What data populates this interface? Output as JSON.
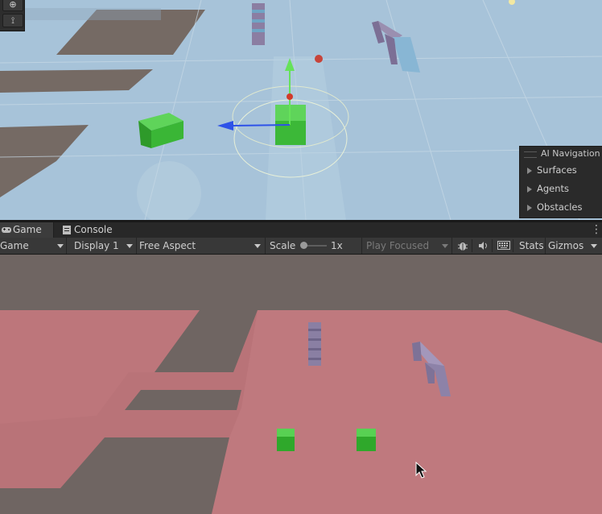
{
  "scene_view": {
    "tools": [
      {
        "icon": "orientation-gizmo-icon"
      },
      {
        "icon": "path-tool-icon"
      }
    ],
    "ai_navigation_overlay": {
      "title": "AI Navigation",
      "items": [
        "Surfaces",
        "Agents",
        "Obstacles"
      ]
    }
  },
  "tabs": [
    {
      "label": "Game",
      "icon": "gamepad-icon",
      "active": true
    },
    {
      "label": "Console",
      "icon": "console-icon",
      "active": false
    }
  ],
  "game_toolbar": {
    "view_mode": "Game",
    "display": "Display 1",
    "aspect": "Free Aspect",
    "scale_label": "Scale",
    "scale_value": "1x",
    "play_mode": "Play Focused",
    "stats_label": "Stats",
    "gizmos_label": "Gizmos",
    "icons": [
      "bug-icon",
      "speaker-icon",
      "keyboard-icon"
    ]
  },
  "colors": {
    "navmesh_blue": "#a8c6dc",
    "navmesh_red": "#c98a8c",
    "cube_green": "#3fb53a",
    "obstacle_purple": "#8a7fa3"
  }
}
